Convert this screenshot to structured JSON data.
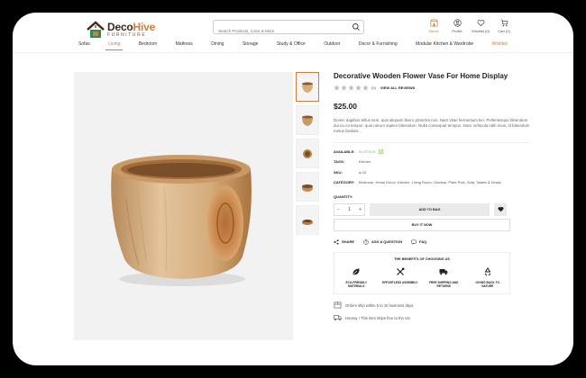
{
  "header": {
    "logo_name_a": "Deco",
    "logo_name_b": "Hive",
    "logo_sub": "FURNITURE",
    "search_placeholder": "Search Products, Color & More",
    "icons": [
      {
        "name": "stores-icon",
        "label": "Stores"
      },
      {
        "name": "profile-icon",
        "label": "Profile"
      },
      {
        "name": "wishlist-icon",
        "label": "Wishlist (0)"
      },
      {
        "name": "cart-icon",
        "label": "Cart (0)"
      }
    ],
    "accent": "#c8803a"
  },
  "nav": {
    "items": [
      "Sofas",
      "Living",
      "Bedroom",
      "Mattress",
      "Dining",
      "Storage",
      "Study & Office",
      "Outdoor",
      "Decor & Furnishing",
      "Modular Kitchen & Wardrobe",
      "Wishlist"
    ],
    "active": "Living"
  },
  "product": {
    "title": "Decorative Wooden Flower Vase For Home Display",
    "review_count": "(0)",
    "view_reviews": "VIEW ALL REVIEWS",
    "price": "$25.00",
    "description": "Donec dapibus tellus sem, quis aliquam libero pharetra non. Nam vitae fermentum leo. Pellentesque bibendum dui eu mi tempor, quis rutrum sapien bibendum. Nulla consequat tempus. Nunc vehicula nibh risus, id bibendum metus facilisis...",
    "specs": {
      "available_k": "AVAILABLE:",
      "available_v": "IN STOCK",
      "tags_k": "TAGS:",
      "tags_v": "Kitchen",
      "sku_k": "SKU:",
      "sku_v": "a-03",
      "category_k": "CATEGORY:",
      "category_v": "Bedroom, Home Decor, Kitchen, Living Room, Outdoor, Plant Pots, Sofa, Tables & Desks"
    },
    "quantity_label": "QUANTITY:",
    "quantity": "1",
    "minus": "−",
    "plus": "+",
    "add_to_bag": "ADD TO BAG",
    "buy_now": "BUY IT NOW",
    "share": "SHARE",
    "ask": "ASK A QUESTION",
    "faq": "FAQ"
  },
  "benefits": {
    "title": "THE BENEFITS OF CHOOSING US",
    "items": [
      {
        "icon": "leaf-icon",
        "label": "ECO-FRIENDLY MATERIALS"
      },
      {
        "icon": "tools-icon",
        "label": "EFFORTLESS ASSEMBLY"
      },
      {
        "icon": "truck-icon",
        "label": "FREE SHIPPING AND RETURNS"
      },
      {
        "icon": "recycle-icon",
        "label": "GIVING BACK TO NATURE"
      }
    ]
  },
  "shipping": {
    "orders": "Orders ship within 5 to 10 business days.",
    "free": "Hooray ! This item ships free to the US"
  }
}
